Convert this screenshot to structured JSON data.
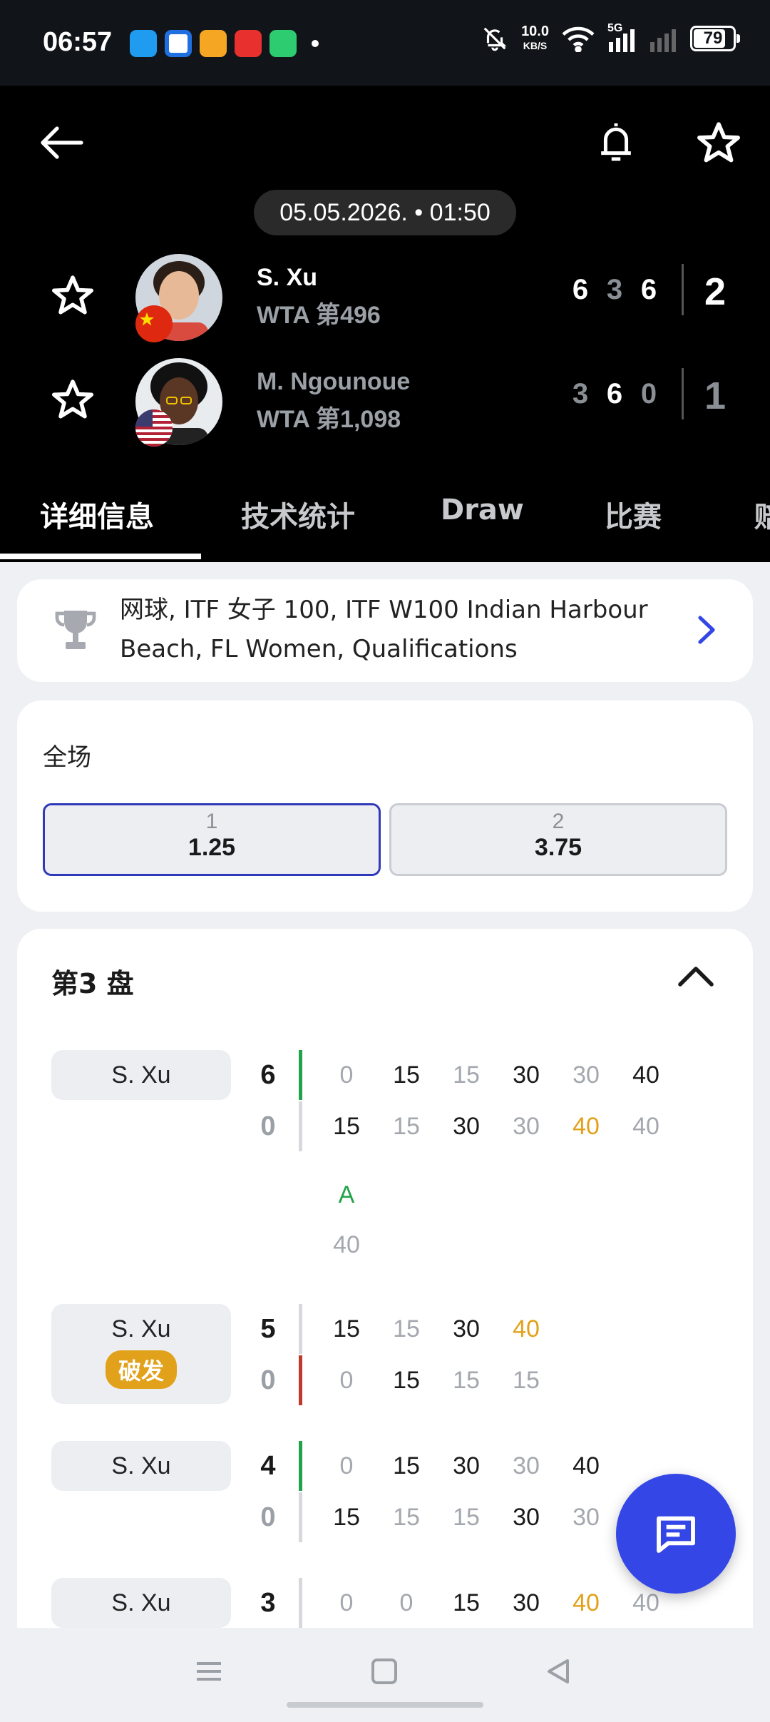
{
  "status_bar": {
    "time": "06:57",
    "net_speed": "10.0",
    "net_unit": "KB/S",
    "network": "5G",
    "battery": "79",
    "app_icons": [
      "browser-icon",
      "video-icon",
      "weibo-icon",
      "toutiao-icon",
      "player-icon"
    ]
  },
  "header": {
    "datetime": "05.05.2026. • 01:50",
    "players": [
      {
        "name": "S. Xu",
        "rank": "WTA 第496",
        "sets": [
          "6",
          "3",
          "6"
        ],
        "total": "2",
        "flag": "china-flag"
      },
      {
        "name": "M. Ngounoue",
        "rank": "WTA 第1,098",
        "sets": [
          "3",
          "6",
          "0"
        ],
        "total": "1",
        "flag": "usa-flag"
      }
    ],
    "tabs": [
      "详细信息",
      "技术统计",
      "Draw",
      "比赛",
      "赔"
    ]
  },
  "tournament": {
    "text": "网球, ITF 女子 100, ITF W100 Indian Harbour Beach, FL Women, Qualifications"
  },
  "odds": {
    "title": "全场",
    "options": [
      {
        "label": "1",
        "value": "1.25"
      },
      {
        "label": "2",
        "value": "3.75"
      }
    ]
  },
  "set": {
    "title": "第3 盘",
    "games": [
      {
        "server": "S. Xu",
        "badge": "",
        "top_score": "6",
        "bottom_score": "0",
        "top_points": [
          "0",
          "15",
          "15",
          "30",
          "30",
          "40"
        ],
        "bottom_points": [
          "15",
          "15",
          "30",
          "30",
          "40",
          "40"
        ],
        "extra_top": "A",
        "extra_bottom": "40"
      },
      {
        "server": "S. Xu",
        "badge": "破发",
        "top_score": "5",
        "bottom_score": "0",
        "top_points": [
          "15",
          "15",
          "30",
          "40"
        ],
        "bottom_points": [
          "0",
          "15",
          "15",
          "15"
        ]
      },
      {
        "server": "S. Xu",
        "badge": "",
        "top_score": "4",
        "bottom_score": "0",
        "top_points": [
          "0",
          "15",
          "30",
          "30",
          "40"
        ],
        "bottom_points": [
          "15",
          "15",
          "15",
          "30",
          "30"
        ]
      },
      {
        "server": "S. Xu",
        "badge": "",
        "top_score": "3",
        "bottom_score": "",
        "top_points": [
          "0",
          "0",
          "15",
          "30",
          "40",
          "40"
        ],
        "bottom_points": []
      }
    ]
  },
  "colors": {
    "accent": "#3447e6",
    "selected_border": "#2f3ab8",
    "hold_green": "#21a34a",
    "break_red": "#c0392b",
    "gold": "#e2a11a"
  }
}
